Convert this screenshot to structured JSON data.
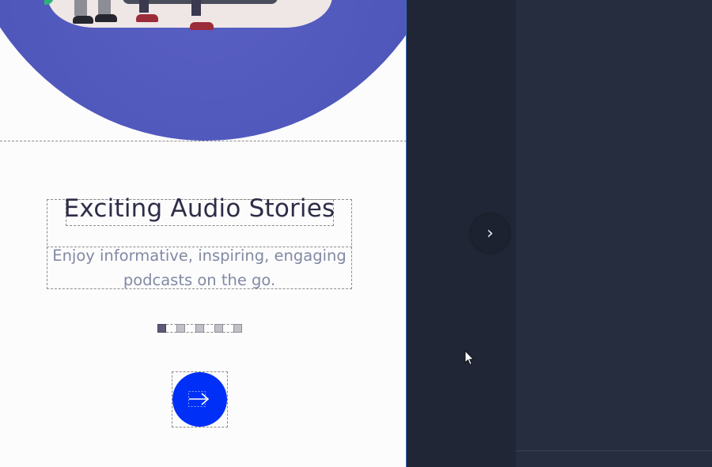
{
  "onboarding": {
    "title": "Exciting Audio Stories",
    "subtitle": "Enjoy informative, inspiring, engaging podcasts on the go.",
    "page_count": 5,
    "active_page": 1,
    "next_icon": "arrow-right-icon",
    "button_color": "#0030f7"
  },
  "editor": {
    "panel_toggle_icon": "chevron-right-icon",
    "panel_toggle_glyph": "›",
    "accent_divider_color": "#3b6fb6",
    "background_color": "#242a38"
  },
  "cursor": {
    "icon": "mouse-pointer-icon"
  }
}
